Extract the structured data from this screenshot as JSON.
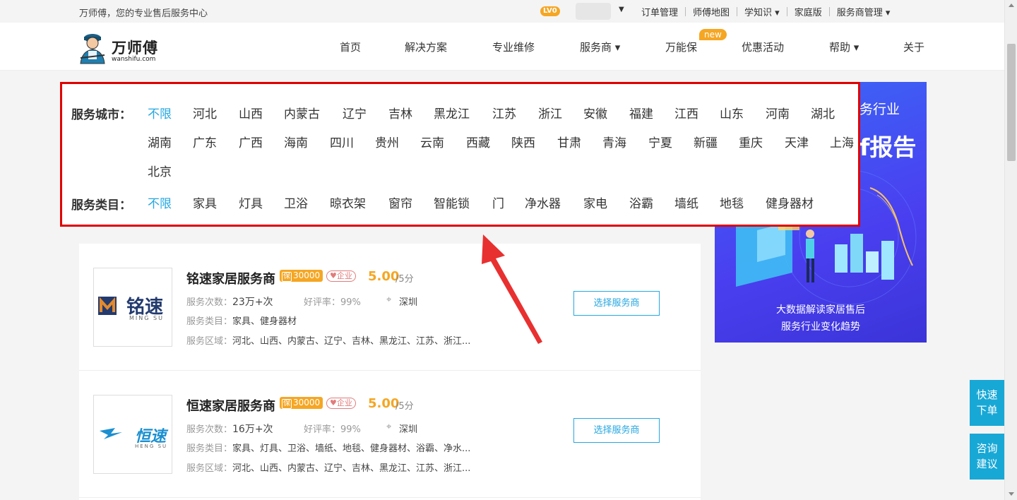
{
  "topbar": {
    "welcome": "万师傅，您的专业售后服务中心",
    "level": "LV0",
    "links": [
      "订单管理",
      "师傅地图",
      "学知识 ▾",
      "家庭版",
      "服务商管理 ▾"
    ]
  },
  "header": {
    "brand": "万师傅",
    "brand_url": "wanshifu.com",
    "nav": [
      "首页",
      "解决方案",
      "专业维修",
      "服务商 ▾",
      "万能保",
      "优惠活动",
      "帮助 ▾",
      "关于"
    ],
    "new_badge": "new"
  },
  "filter": {
    "city_label": "服务城市：",
    "cities": [
      "不限",
      "河北",
      "山西",
      "内蒙古",
      "辽宁",
      "吉林",
      "黑龙江",
      "江苏",
      "浙江",
      "安徽",
      "福建",
      "江西",
      "山东",
      "河南",
      "湖北",
      "湖南",
      "广东",
      "广西",
      "海南",
      "四川",
      "贵州",
      "云南",
      "西藏",
      "陕西",
      "甘肃",
      "青海",
      "宁夏",
      "新疆",
      "重庆",
      "天津",
      "上海",
      "北京"
    ],
    "category_label": "服务类目：",
    "categories": [
      "不限",
      "家具",
      "灯具",
      "卫浴",
      "晾衣架",
      "窗帘",
      "智能锁",
      "门",
      "净水器",
      "家电",
      "浴霸",
      "墙纸",
      "地毯",
      "健身器材"
    ]
  },
  "banner": {
    "title_fragment": "务行业",
    "big_fragment": "f报告",
    "caption1": "大数据解读家居售后",
    "caption2": "服务行业变化趋势"
  },
  "providers": [
    {
      "name": "铭速家居服务商",
      "deposit": "30000",
      "deposit_icon": "保",
      "tag": "企业",
      "score": "5.00",
      "score_max": "/5分",
      "service_count_label": "服务次数：",
      "service_count": "23万+次",
      "rating_label": "好评率：99%",
      "location": "深圳",
      "category_label": "服务类目：",
      "categories": "家具、健身器材",
      "area_label": "服务区域：",
      "areas": "河北、山西、内蒙古、辽宁、吉林、黑龙江、江苏、浙江...",
      "logo_text": "铭速",
      "logo_sub": "MING SU",
      "button": "选择服务商"
    },
    {
      "name": "恒速家居服务商",
      "deposit": "30000",
      "deposit_icon": "保",
      "tag": "企业",
      "score": "5.00",
      "score_max": "/5分",
      "service_count_label": "服务次数：",
      "service_count": "16万+次",
      "rating_label": "好评率：99%",
      "location": "深圳",
      "category_label": "服务类目：",
      "categories": "家具、灯具、卫浴、墙纸、地毯、健身器材、浴霸、净水...",
      "area_label": "服务区域：",
      "areas": "河北、山西、内蒙古、辽宁、吉林、黑龙江、江苏、浙江...",
      "logo_text": "恒速",
      "logo_sub": "HENG SU",
      "button": "选择服务商"
    }
  ],
  "float_buttons": [
    {
      "line1": "快速",
      "line2": "下单"
    },
    {
      "line1": "咨询",
      "line2": "建议"
    }
  ],
  "colors": {
    "accent": "#26a7e0",
    "highlight_border": "#e00000",
    "orange": "#f5a623",
    "float": "#18a8d6"
  }
}
